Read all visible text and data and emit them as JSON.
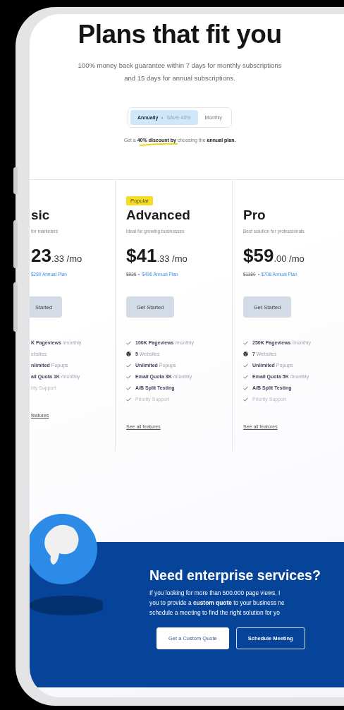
{
  "header": {
    "title": "Plans that fit you",
    "subtitle": "100% money back guarantee within 7 days for monthly subscriptions and 15 days for annual subscriptions."
  },
  "billing_toggle": [
    {
      "label": "Annually",
      "badge": "SAVE 40%",
      "selected": true
    },
    {
      "label": "Monthly",
      "selected": false
    }
  ],
  "discount_note": "Get a **40% discount by** choosing the **annual plan.**",
  "plans": [
    {
      "name": "sic",
      "tagline": "for marketers",
      "price_main": "23",
      "price_cents": ".33 /mo",
      "annual": "$280 Annual Plan",
      "button": "Started",
      "features": [
        {
          "kind": "plain",
          "text": "**K Pageviews** /monthly",
          "muted": false
        },
        {
          "kind": "plain",
          "text": "ebsites",
          "muted": false
        },
        {
          "kind": "plain",
          "text": "**nlimited** Popups",
          "muted": false
        },
        {
          "kind": "plain",
          "text": "**ail Quota 1K** /monthly",
          "muted": false
        },
        {
          "kind": "plain",
          "text": "rity Support",
          "muted": true
        }
      ],
      "link": "features"
    },
    {
      "name": "Advanced",
      "badge": "Popular",
      "tagline": "Ideal for growing businesses",
      "price_main": "$41",
      "price_cents": ".33 /mo",
      "old_price": "$826",
      "annual": "$496 Annual Plan",
      "button": "Get Started",
      "features": [
        {
          "kind": "check",
          "text": "**100K Pageviews** /monthly",
          "muted": false
        },
        {
          "kind": "globe",
          "text": "**5** Websites",
          "muted": false
        },
        {
          "kind": "check",
          "text": "**Unlimited** Popups",
          "muted": false
        },
        {
          "kind": "check",
          "text": "**Email Quota 3K** /monthly",
          "muted": false
        },
        {
          "kind": "check",
          "text": "**A/B Split Testing**",
          "muted": false
        },
        {
          "kind": "check",
          "text": "Priority Support",
          "muted": true
        }
      ],
      "link": "See all features"
    },
    {
      "name": "Pro",
      "tagline": "Best solution for professionals",
      "price_main": "$59",
      "price_cents": ".00 /mo",
      "old_price": "$1180",
      "annual": "$708 Annual Plan",
      "button": "Get Started",
      "features": [
        {
          "kind": "check",
          "text": "**250K Pageviews** /monthly",
          "muted": false
        },
        {
          "kind": "globe",
          "text": "**7** Websites",
          "muted": false
        },
        {
          "kind": "check",
          "text": "**Unlimited** Popups",
          "muted": false
        },
        {
          "kind": "check",
          "text": "**Email Quota 5K** /monthly",
          "muted": false
        },
        {
          "kind": "check",
          "text": "**A/B Split Testing**",
          "muted": false
        },
        {
          "kind": "check",
          "text": "Priority Support",
          "muted": true
        }
      ],
      "link": "See all features"
    }
  ],
  "enterprise": {
    "title": "Need enterprise services?",
    "lines": [
      "If you looking for more than 500.000 page views, I",
      "you to provide a **custom quote** to your business ne",
      "schedule a meeting to find the right solution for yo"
    ],
    "buttons": [
      {
        "label": "Get a Custom Quote",
        "kind": "solid"
      },
      {
        "label": "Schedule Meeting",
        "kind": "outline"
      }
    ]
  }
}
